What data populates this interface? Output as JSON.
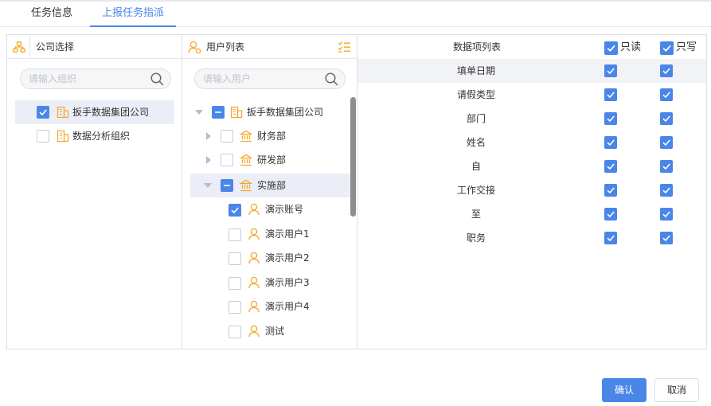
{
  "tabs": [
    {
      "label": "任务信息",
      "active": false
    },
    {
      "label": "上报任务指派",
      "active": true
    }
  ],
  "company_panel": {
    "title": "公司选择",
    "search_placeholder": "请输入组织",
    "items": [
      {
        "label": "扳手数据集团公司",
        "checked": true,
        "selected": true
      },
      {
        "label": "数据分析组织",
        "checked": false,
        "selected": false
      }
    ]
  },
  "user_panel": {
    "title": "用户列表",
    "search_placeholder": "请输入用户",
    "root": {
      "label": "扳手数据集团公司",
      "state": "partial",
      "expanded": true
    },
    "departments": [
      {
        "label": "财务部",
        "state": "unchecked",
        "expanded": false
      },
      {
        "label": "研发部",
        "state": "unchecked",
        "expanded": false
      },
      {
        "label": "实施部",
        "state": "partial",
        "expanded": true,
        "selected": true
      }
    ],
    "users": [
      {
        "label": "演示账号",
        "checked": true
      },
      {
        "label": "演示用户1",
        "checked": false
      },
      {
        "label": "演示用户2",
        "checked": false
      },
      {
        "label": "演示用户3",
        "checked": false
      },
      {
        "label": "演示用户4",
        "checked": false
      },
      {
        "label": "测试",
        "checked": false
      }
    ]
  },
  "fields_panel": {
    "title": "数据项列表",
    "readonly_label": "只读",
    "writeonly_label": "只写",
    "readonly_all": true,
    "writeonly_all": true,
    "rows": [
      {
        "name": "填单日期",
        "readonly": true,
        "writeonly": true
      },
      {
        "name": "请假类型",
        "readonly": true,
        "writeonly": true
      },
      {
        "name": "部门",
        "readonly": true,
        "writeonly": true
      },
      {
        "name": "姓名",
        "readonly": true,
        "writeonly": true
      },
      {
        "name": "自",
        "readonly": true,
        "writeonly": true
      },
      {
        "name": "工作交接",
        "readonly": true,
        "writeonly": true
      },
      {
        "name": "至",
        "readonly": true,
        "writeonly": true
      },
      {
        "name": "职务",
        "readonly": true,
        "writeonly": true
      }
    ]
  },
  "buttons": {
    "confirm": "确认",
    "cancel": "取消"
  },
  "colors": {
    "accent": "#4a86e8",
    "icon_orange": "#f5a623",
    "highlight_row": "#f2f3f7",
    "selected_row": "#ebeef7"
  }
}
